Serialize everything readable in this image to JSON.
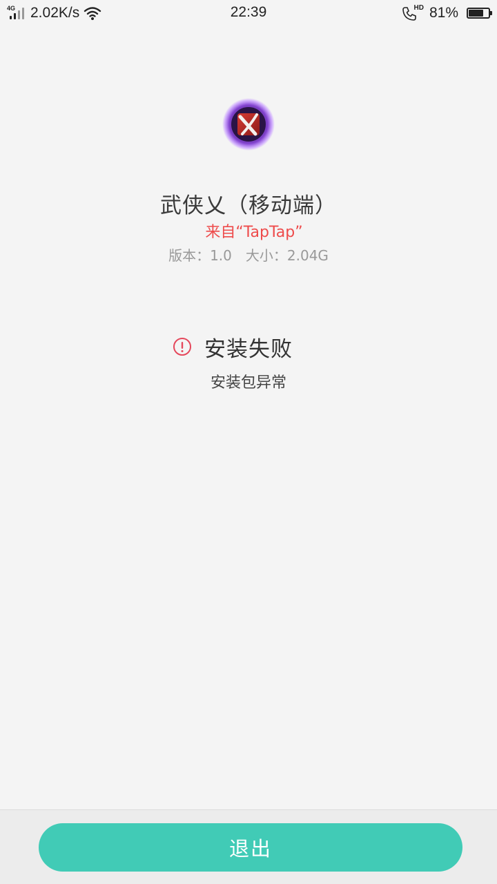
{
  "status_bar": {
    "network_type": "4G",
    "speed": "2.02K/s",
    "time": "22:39",
    "call_badge": "HD",
    "battery_percent": "81%",
    "battery_level": 0.81
  },
  "app": {
    "icon": "wuxia-yi-app-icon",
    "name": "武侠乂（移动端）",
    "source": "来自“TapTap”",
    "version_label": "版本：1.0",
    "size_label": "大小：2.04G"
  },
  "install_status": {
    "icon": "error-circle-icon",
    "title": "安装失败",
    "description": "安装包异常"
  },
  "actions": {
    "exit_label": "退出"
  },
  "colors": {
    "accent": "#41cbb6",
    "error": "#e5475b",
    "source_text": "#ee4b4b",
    "background": "#f4f4f4"
  }
}
